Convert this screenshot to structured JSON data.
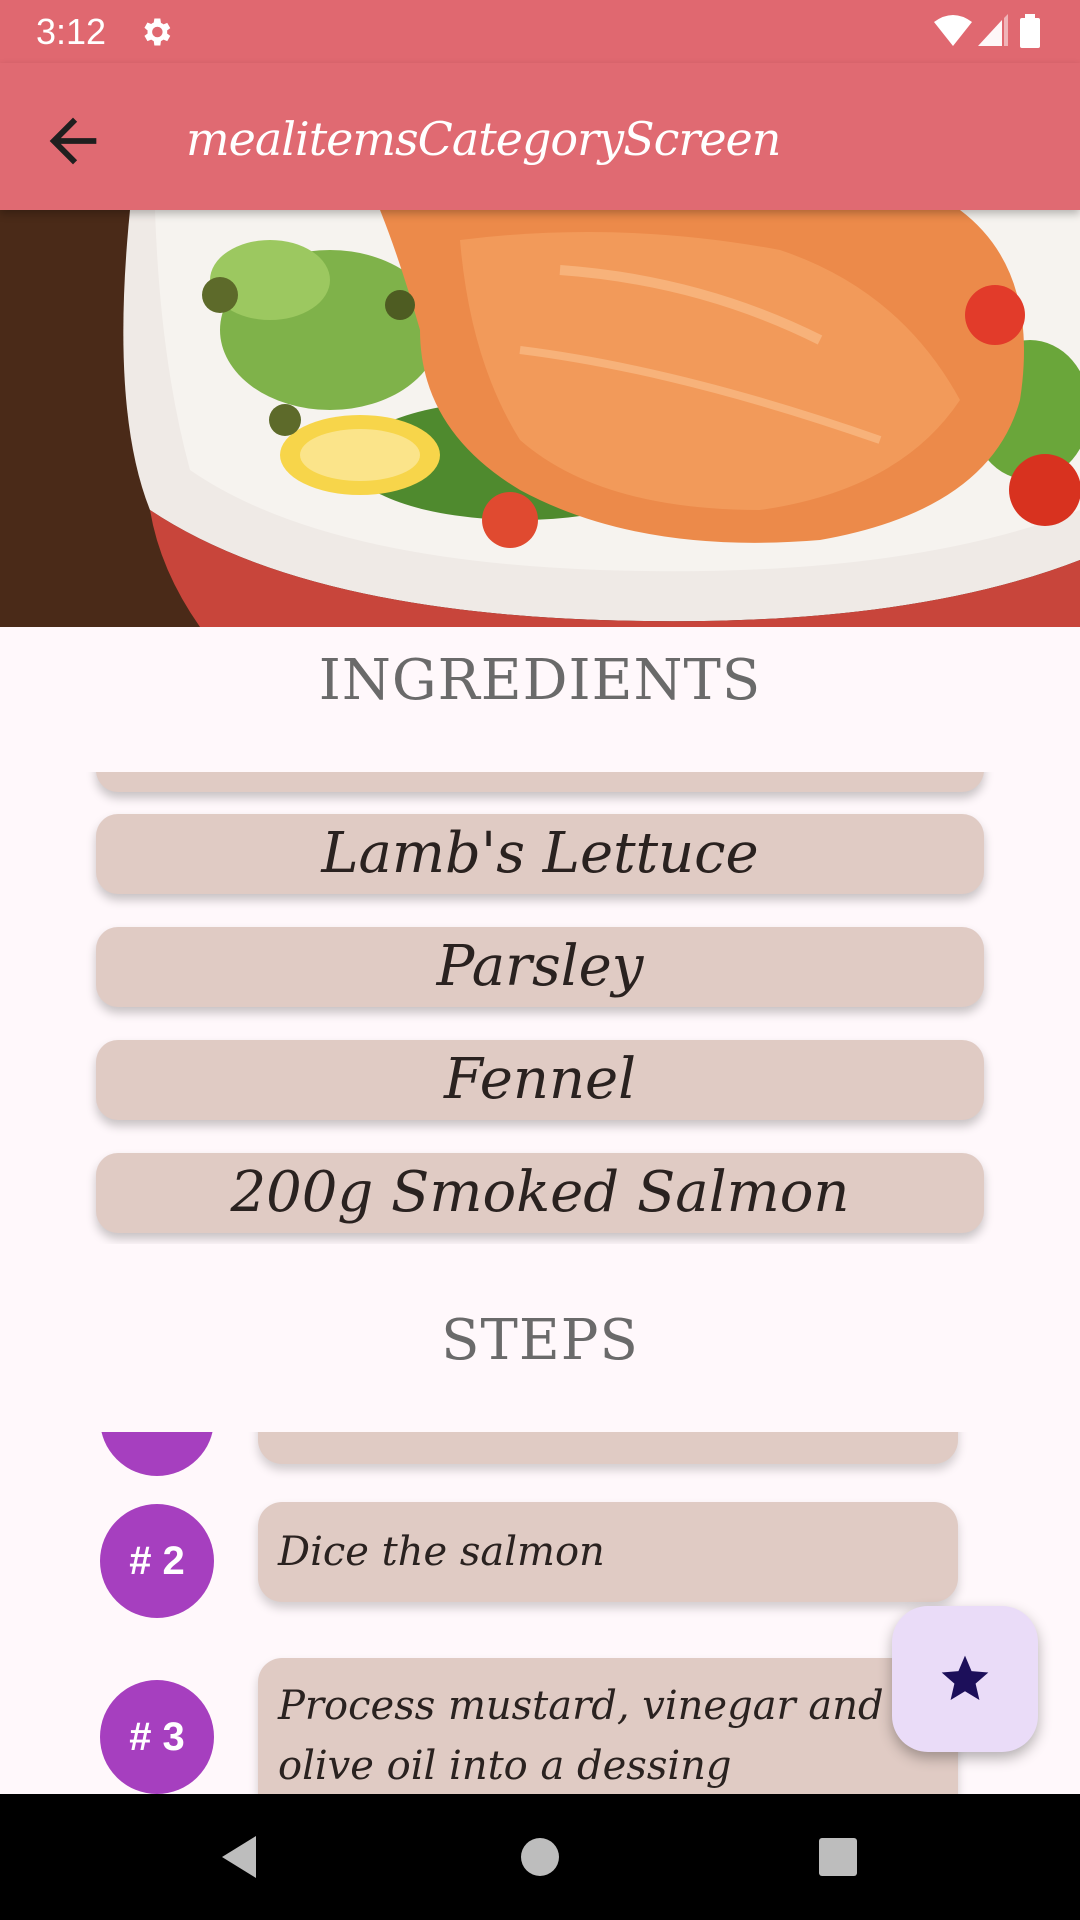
{
  "status_bar": {
    "time": "3:12"
  },
  "app_bar": {
    "title": "mealitemsCategoryScreen"
  },
  "ingredients": {
    "heading": "INGREDIENTS",
    "items": [
      "Lamb's Lettuce",
      "Parsley",
      "Fennel",
      "200g Smoked Salmon"
    ]
  },
  "steps": {
    "heading": "STEPS",
    "items": [
      {
        "badge": "# 2",
        "text": "Dice the salmon"
      },
      {
        "badge": "# 3",
        "text": "Process mustard, vinegar and olive oil into a dessing"
      }
    ]
  },
  "colors": {
    "app_bar": "#e06a72",
    "card": "#e0cbc4",
    "badge": "#a63fbf",
    "fab": "#eadcf8",
    "heading_text": "#6a6a6a"
  },
  "icons": {
    "back": "arrow-back-icon",
    "fab": "star-icon",
    "settings": "gear-icon"
  }
}
